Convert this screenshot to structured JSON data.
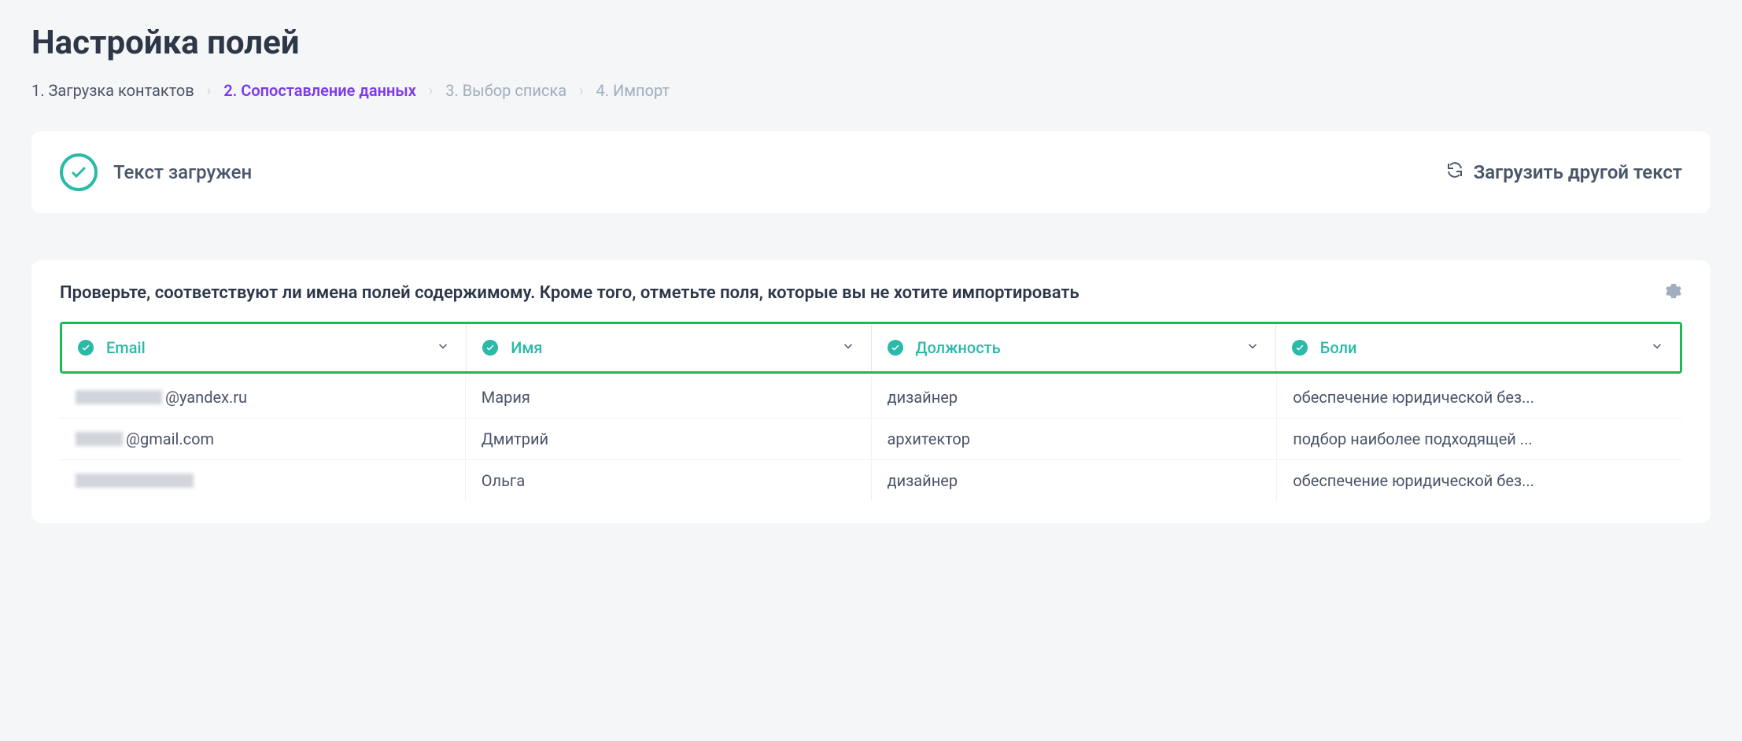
{
  "title": "Настройка полей",
  "breadcrumb": {
    "step1": "1. Загрузка контактов",
    "step2": "2. Сопоставление данных",
    "step3": "3. Выбор списка",
    "step4": "4. Импорт"
  },
  "status": {
    "text": "Текст загружен",
    "reload": "Загрузить другой текст"
  },
  "mapping": {
    "title": "Проверьте, соответствуют ли имена полей содержимому. Кроме того, отметьте поля, которые вы не хотите импортировать",
    "columns": {
      "c1": "Email",
      "c2": "Имя",
      "c3": "Должность",
      "c4": "Боли"
    },
    "rows": [
      {
        "email_suffix": "@yandex.ru",
        "name": "Мария",
        "role": "дизайнер",
        "pain": "обеспечение юридической без..."
      },
      {
        "email_suffix": "@gmail.com",
        "name": "Дмитрий",
        "role": "архитектор",
        "pain": "подбор наиболее подходящей ..."
      },
      {
        "email_suffix": "",
        "name": "Ольга",
        "role": "дизайнер",
        "pain": "обеспечение юридической без..."
      }
    ]
  }
}
